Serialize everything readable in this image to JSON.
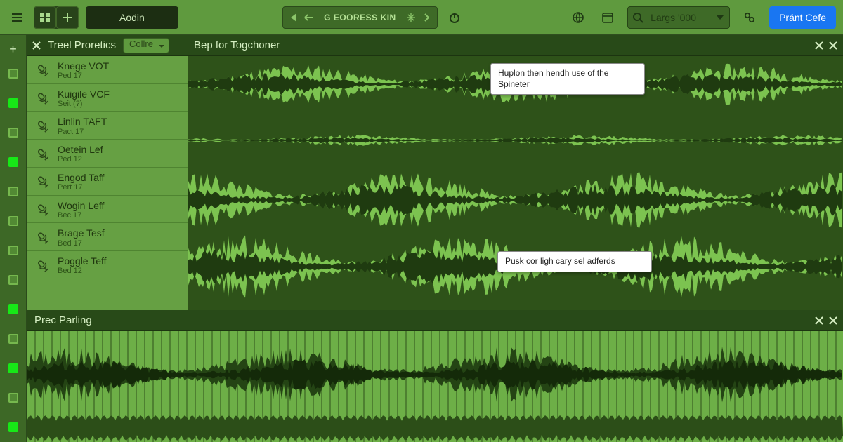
{
  "topbar": {
    "project_title": "Aodin",
    "transport": {
      "title": "G EOORESS KIN"
    },
    "search": {
      "value": "Largs '000"
    },
    "primary_button": "Pránt Cefe"
  },
  "panel_tracks": {
    "title": "Treel Proretics",
    "selector": "Collre",
    "tracks": [
      {
        "name": "Knege VOT",
        "info": "Ped 17"
      },
      {
        "name": "Kuigile VCF",
        "info": "Seit (?)"
      },
      {
        "name": "Linlin TAFT",
        "info": "Pact 17"
      },
      {
        "name": "Oetein Lef",
        "info": "Ped 12"
      },
      {
        "name": "Engod Taff",
        "info": "Pert 17"
      },
      {
        "name": "Wogin Leff",
        "info": "Bec 17"
      },
      {
        "name": "Brage Tesf",
        "info": "Bed 17"
      },
      {
        "name": "Poggle Teff",
        "info": "Bed 12"
      }
    ]
  },
  "panel_main": {
    "title": "Bep for Togchoner"
  },
  "panel_lower": {
    "title": "Prec Parling"
  },
  "tooltips": {
    "a": "Huplon then hendh use of the Spineter",
    "b": "Pusk cor ligh cary sel adferds"
  },
  "markers": [
    "outline",
    "solid",
    "outline",
    "solid",
    "outline",
    "outline",
    "outline",
    "outline",
    "solid",
    "outline",
    "solid",
    "outline",
    "solid"
  ],
  "colors": {
    "accent": "#1976f2",
    "wave_light": "#7cc350",
    "wave_dark": "#1f3b10"
  }
}
